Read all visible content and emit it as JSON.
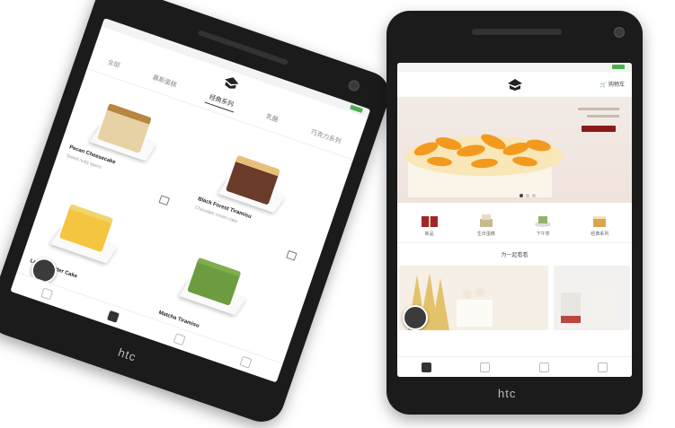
{
  "brand_logo_text": "htc",
  "left_phone": {
    "tabs": [
      "全部",
      "慕斯蛋糕",
      "经典系列",
      "乳酪",
      "巧克力系列"
    ],
    "active_tab": 2,
    "products": [
      {
        "name": "Pecan Cheesecake",
        "desc": "Sweet nutty layers",
        "cake_color": "#e6d2a4",
        "top_color": "#b7863f"
      },
      {
        "name": "Black Forest Tiramisu",
        "desc": "Chocolate cream cake",
        "cake_color": "#6b3b2a",
        "top_color": "#e8c07a"
      },
      {
        "name": "Lemon Butter Cake",
        "desc": "",
        "cake_color": "#f5c542",
        "top_color": "#f2d46a"
      },
      {
        "name": "Matcha Tiramisu",
        "desc": "",
        "cake_color": "#6d9b3f",
        "top_color": "#7fae4a"
      }
    ]
  },
  "right_phone": {
    "cart_label": "购物车",
    "banner": {
      "button_color": "#8a1b1b"
    },
    "categories": [
      {
        "label": "新品",
        "color": "#a0262a"
      },
      {
        "label": "生日蛋糕",
        "color": "#c8b98f"
      },
      {
        "label": "下午茶",
        "color": "#8fb36b"
      },
      {
        "label": "经典系列",
        "color": "#d9a650"
      }
    ],
    "section_title": "为一起看看"
  },
  "colors": {
    "phone_body": "#1b1b1b",
    "accent": "#8a1b1b"
  }
}
